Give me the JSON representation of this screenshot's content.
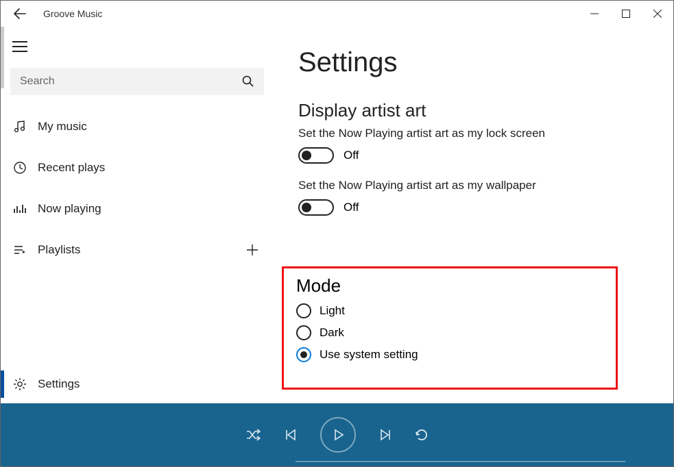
{
  "titlebar": {
    "app_name": "Groove Music"
  },
  "search": {
    "placeholder": "Search"
  },
  "sidebar": {
    "items": [
      {
        "label": "My music"
      },
      {
        "label": "Recent plays"
      },
      {
        "label": "Now playing"
      },
      {
        "label": "Playlists"
      }
    ],
    "settings_label": "Settings"
  },
  "content": {
    "page_title": "Settings",
    "artist_art": {
      "section_title": "Display artist art",
      "lock_screen_desc": "Set the Now Playing artist art as my lock screen",
      "lock_screen_state": "Off",
      "wallpaper_desc": "Set the Now Playing artist art as my wallpaper",
      "wallpaper_state": "Off"
    },
    "mode": {
      "section_title": "Mode",
      "options": [
        {
          "label": "Light",
          "selected": false
        },
        {
          "label": "Dark",
          "selected": false
        },
        {
          "label": "Use system setting",
          "selected": true
        }
      ]
    }
  }
}
